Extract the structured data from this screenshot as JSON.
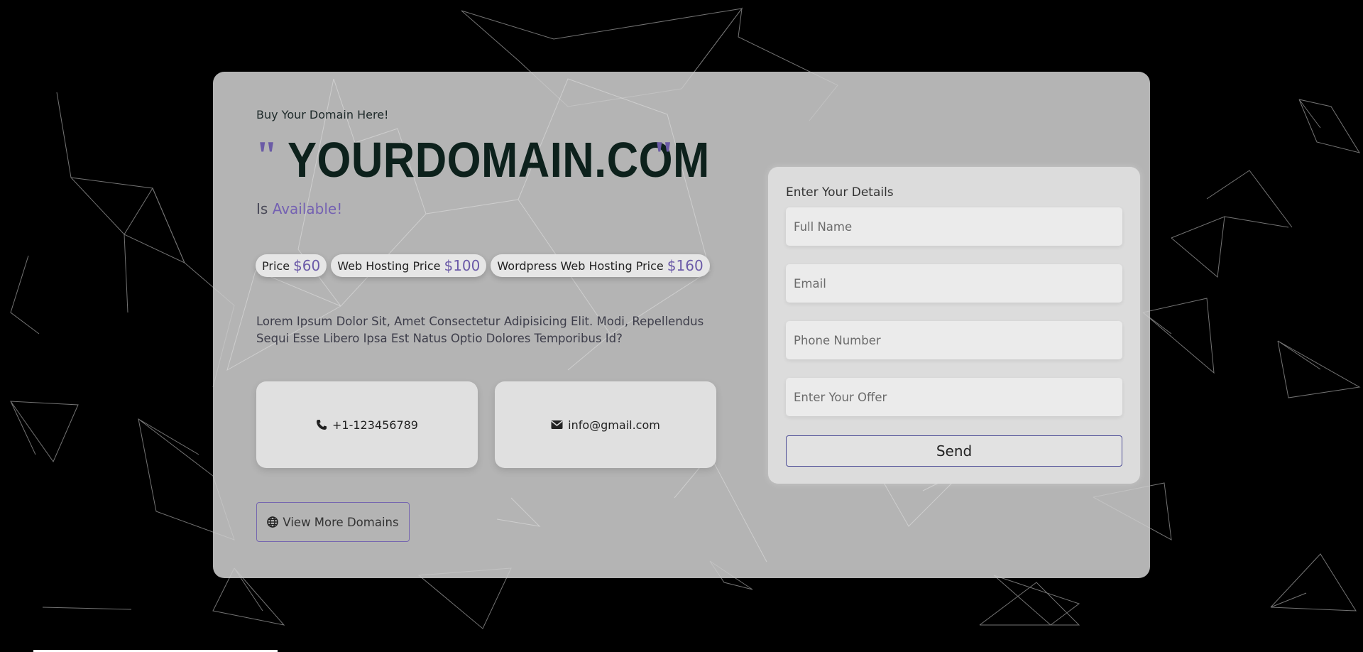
{
  "hero": {
    "tagline": "Buy Your Domain Here!",
    "open_quote": "\"",
    "domain": "YOURDOMAIN.COM",
    "close_quote": "\"",
    "status_prefix": "Is",
    "status_value": "Available!"
  },
  "prices": [
    {
      "label": "Price",
      "amount": "$60"
    },
    {
      "label": "Web Hosting Price",
      "amount": "$100"
    },
    {
      "label": "Wordpress Web Hosting Price",
      "amount": "$160"
    }
  ],
  "description": "Lorem Ipsum Dolor Sit, Amet Consectetur Adipisicing Elit. Modi, Repellendus Sequi Esse Libero Ipsa Est Natus Optio Dolores Temporibus Id?",
  "contacts": {
    "phone": {
      "icon": "phone-icon",
      "text": "+1-123456789"
    },
    "email": {
      "icon": "envelope-icon",
      "text": "info@gmail.com"
    }
  },
  "more_button": {
    "icon": "globe-icon",
    "label": "View More Domains"
  },
  "form": {
    "title": "Enter Your Details",
    "full_name_placeholder": "Full Name",
    "email_placeholder": "Email",
    "phone_placeholder": "Phone Number",
    "offer_placeholder": "Enter Your Offer",
    "submit_label": "Send"
  },
  "colors": {
    "accent": "#7461b2",
    "domain_text": "#0d211c",
    "background": "#000000",
    "card": "#cdcdcd"
  }
}
